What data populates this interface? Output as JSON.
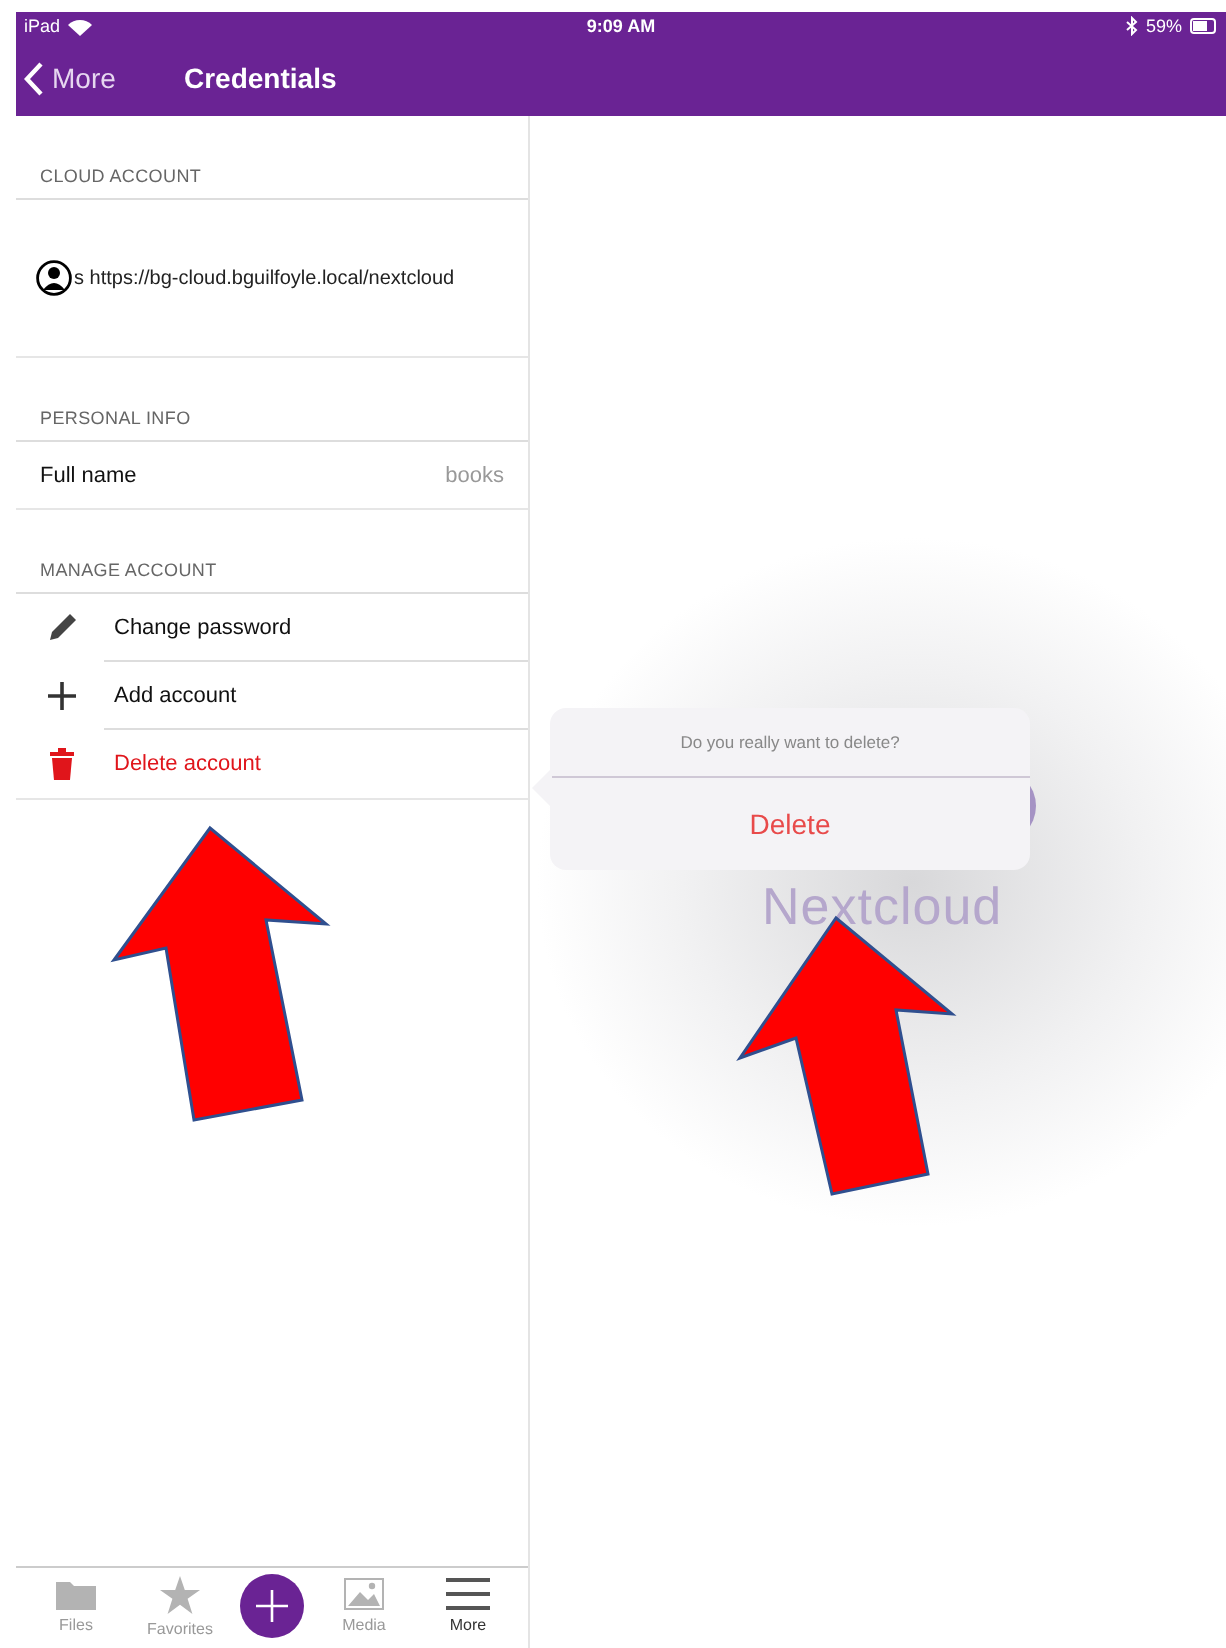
{
  "status_bar": {
    "device": "iPad",
    "time": "9:09 AM",
    "battery": "59%"
  },
  "nav_bar": {
    "back": "More",
    "title": "Credentials"
  },
  "sections": [
    {
      "header": "CLOUD ACCOUNT",
      "rows": [
        {
          "kind": "account",
          "label": "s https://bg-cloud.bguilfoyle.local/nextcloud"
        }
      ]
    },
    {
      "header": "PERSONAL INFO",
      "rows": [
        {
          "kind": "value",
          "label": "Full name",
          "value": "books"
        }
      ]
    },
    {
      "header": "MANAGE ACCOUNT",
      "rows": [
        {
          "kind": "action",
          "label": "Change password",
          "destructive": false
        },
        {
          "kind": "action",
          "label": "Add account",
          "destructive": false
        },
        {
          "kind": "action",
          "label": "Delete account",
          "destructive": true
        }
      ]
    }
  ],
  "tab_bar": [
    {
      "kind": "tab",
      "label": "Files",
      "selected": false
    },
    {
      "kind": "tab",
      "label": "Favorites",
      "selected": false
    },
    {
      "kind": "add"
    },
    {
      "kind": "tab",
      "label": "Media",
      "selected": false
    },
    {
      "kind": "tab",
      "label": "More",
      "selected": true
    }
  ],
  "logo": {
    "text": "Nextcloud"
  },
  "popover": {
    "message": "Do you really want to delete?",
    "action": "Delete"
  },
  "annotations": [
    {
      "kind": "arrow",
      "color": "#ff0000"
    },
    {
      "kind": "arrow",
      "color": "#ff0000"
    }
  ]
}
